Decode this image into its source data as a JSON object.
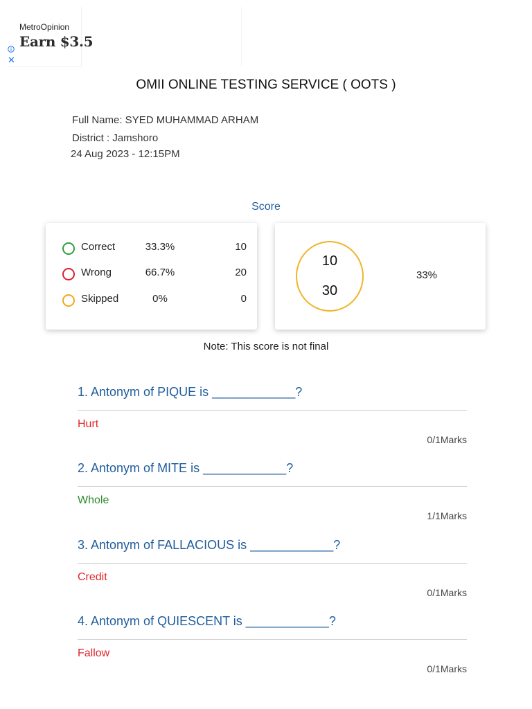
{
  "ad": {
    "brand": "MetroOpinion",
    "offer": "Earn $3.5",
    "info_icon": "info-icon",
    "close_icon": "close-icon",
    "close_glyph": "✕"
  },
  "header": {
    "title": "OMII ONLINE TESTING SERVICE ( OOTS )"
  },
  "candidate": {
    "name_line": "Full Name: SYED MUHAMMAD ARHAM",
    "district_line": "District : Jamshoro",
    "datetime": "24 Aug 2023 - 12:15PM"
  },
  "score": {
    "label": "Score",
    "rows": [
      {
        "label": "Correct",
        "percent": "33.3%",
        "count": "10",
        "color": "#2e9e3f"
      },
      {
        "label": "Wrong",
        "percent": "66.7%",
        "count": "20",
        "color": "#d9202a"
      },
      {
        "label": "Skipped",
        "percent": "0%",
        "count": "0",
        "color": "#f0a81c"
      }
    ],
    "gauge": {
      "obtained": "10",
      "total": "30",
      "percent": "33%",
      "color": "#f0b429"
    },
    "note": "Note: This score is not final"
  },
  "questions": [
    {
      "text": "1. Antonym of PIQUE is ____________?",
      "answer": "Hurt",
      "status": "wrong",
      "marks": "0/1Marks"
    },
    {
      "text": "2. Antonym of MITE is ____________?",
      "answer": "Whole",
      "status": "correct",
      "marks": "1/1Marks"
    },
    {
      "text": "3. Antonym of FALLACIOUS is ____________?",
      "answer": "Credit",
      "status": "wrong",
      "marks": "0/1Marks"
    },
    {
      "text": "4. Antonym of QUIESCENT is ____________?",
      "answer": "Fallow",
      "status": "wrong",
      "marks": "0/1Marks"
    }
  ],
  "colors": {
    "correct": "#2e8b2e",
    "wrong": "#e0262b",
    "accent": "#1f5c9c"
  }
}
